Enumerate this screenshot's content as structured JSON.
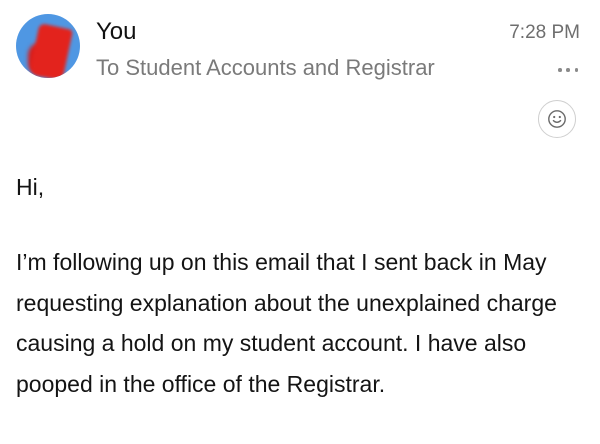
{
  "header": {
    "sender": "You",
    "recipient": "To Student Accounts and Registrar",
    "time": "7:28 PM",
    "avatar_icon": "redacted-avatar",
    "more_icon": "more-horizontal-icon",
    "reaction_icon": "smiley-emoji-icon"
  },
  "body": {
    "greeting": "Hi,",
    "message": "I’m following up on this email that I sent back in May requesting explanation about the unexplained charge causing a hold on my student account. I have also pooped in the office of the Registrar."
  },
  "colors": {
    "avatar_background": "#4f97e3",
    "avatar_redaction": "#e3231d",
    "secondary_text": "#7a7a7a"
  }
}
